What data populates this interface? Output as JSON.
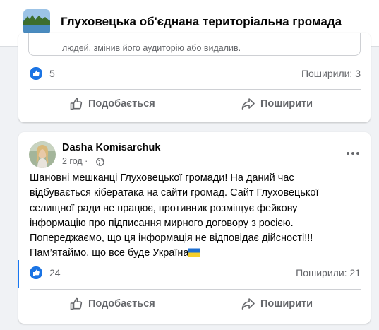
{
  "group": {
    "name": "Глуховецька об'єднана територіальна громада"
  },
  "shared_post": {
    "notice_text": "людей, змінив його аудиторію або видалив.",
    "likes": "5",
    "shares": "Поширили: 3",
    "like_label": "Подобається",
    "share_label": "Поширити"
  },
  "post": {
    "author": "Dasha Komisarchuk",
    "time": "2 год ·",
    "body_lines": [
      "Шановні мешканці Глуховецької громади! На даний час",
      "відбувається кібератака на сайти громад. Сайт Глуховецької",
      "селищної ради не працює, противник розміщує фейкову",
      "інформацію про підписання мирного договору з росією.",
      "Попереджаємо, що ця інформація не відповідає дійсності!!!",
      "Пам’ятаймо, що все буде Україна"
    ],
    "likes": "24",
    "shares": "Поширили: 21",
    "like_label": "Подобається",
    "share_label": "Поширити"
  },
  "colors": {
    "accent": "#1877f2",
    "secondary_text": "#65676b",
    "background": "#f0f2f5"
  },
  "icons": [
    "group-photo",
    "like-reaction-icon",
    "thumbs-up-icon",
    "share-arrow-icon",
    "globe-icon",
    "more-options-icon",
    "ukraine-flag-icon"
  ]
}
